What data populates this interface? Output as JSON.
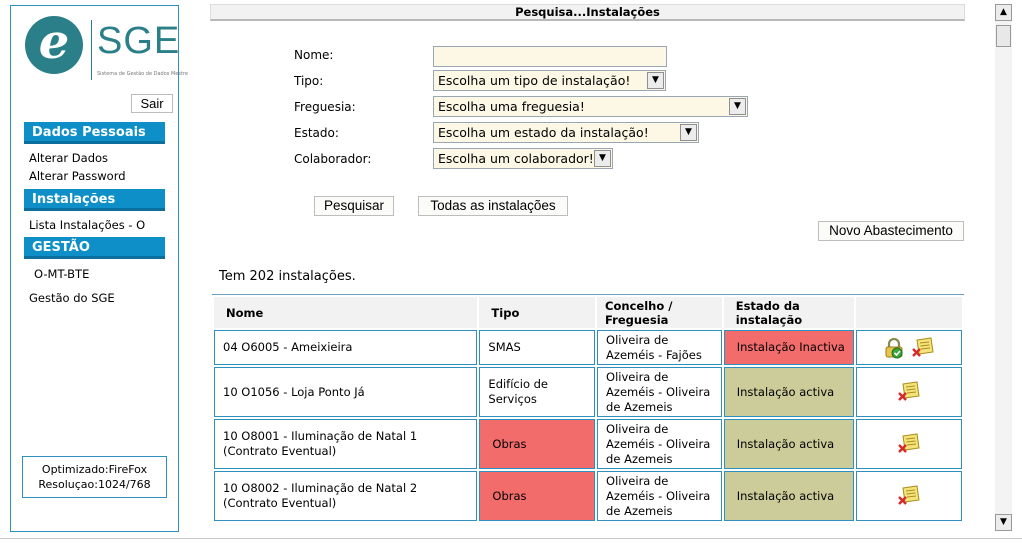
{
  "sidebar": {
    "logo_text": "SGE",
    "logo_subtitle": "Sistema de Gestão de Dados Mestre",
    "logout_label": "Sair",
    "sections": [
      {
        "title": "Dados Pessoais",
        "links": [
          "Alterar Dados",
          "Alterar Password"
        ]
      },
      {
        "title": "Instalações",
        "links": [
          "Lista Instalações - O"
        ]
      },
      {
        "title": "GESTÃO",
        "links": [
          "O-MT-BTE",
          "Gestão do SGE"
        ]
      }
    ],
    "optimized": "Optimizado:FireFox",
    "resolution": "Resoluçao:1024/768"
  },
  "page_title": "Pesquisa...Instalações",
  "form": {
    "nome_label": "Nome:",
    "nome_value": "",
    "tipo_label": "Tipo:",
    "tipo_value": "Escolha um tipo de instalação!",
    "freguesia_label": "Freguesia:",
    "freguesia_value": "Escolha uma freguesia!",
    "estado_label": "Estado:",
    "estado_value": "Escolha um estado da instalação!",
    "colaborador_label": "Colaborador:",
    "colaborador_value": "Escolha um colaborador!"
  },
  "buttons": {
    "pesquisar": "Pesquisar",
    "todas": "Todas as instalações",
    "novo_abastecimento": "Novo Abastecimento"
  },
  "count_text": "Tem 202 instalações.",
  "table": {
    "headers": [
      "Nome",
      "Tipo",
      "Concelho / Freguesia",
      "Estado da instalação",
      ""
    ],
    "rows": [
      {
        "nome": "04 O6005 - Ameixieira",
        "tipo": "SMAS",
        "concelho": "Oliveira de Azeméis - Fajões",
        "estado": "Instalação Inactiva"
      },
      {
        "nome": "10 O1056 - Loja Ponto Já",
        "tipo": "Edifício de Serviços",
        "concelho": "Oliveira de Azeméis - Oliveira de Azemeis",
        "estado": "Instalação activa"
      },
      {
        "nome": "10 O8001 - Iluminação de Natal 1 (Contrato Eventual)",
        "tipo": "Obras",
        "concelho": "Oliveira de Azeméis - Oliveira de Azemeis",
        "estado": "Instalação activa"
      },
      {
        "nome": "10 O8002 - Iluminação de Natal 2 (Contrato Eventual)",
        "tipo": "Obras",
        "concelho": "Oliveira de Azeméis - Oliveira de Azemeis",
        "estado": "Instalação activa"
      }
    ]
  },
  "colors": {
    "accent": "#0e8fc7",
    "inactive": "#f26c6c",
    "active": "#cccc9a",
    "logo": "#2a7f88"
  }
}
